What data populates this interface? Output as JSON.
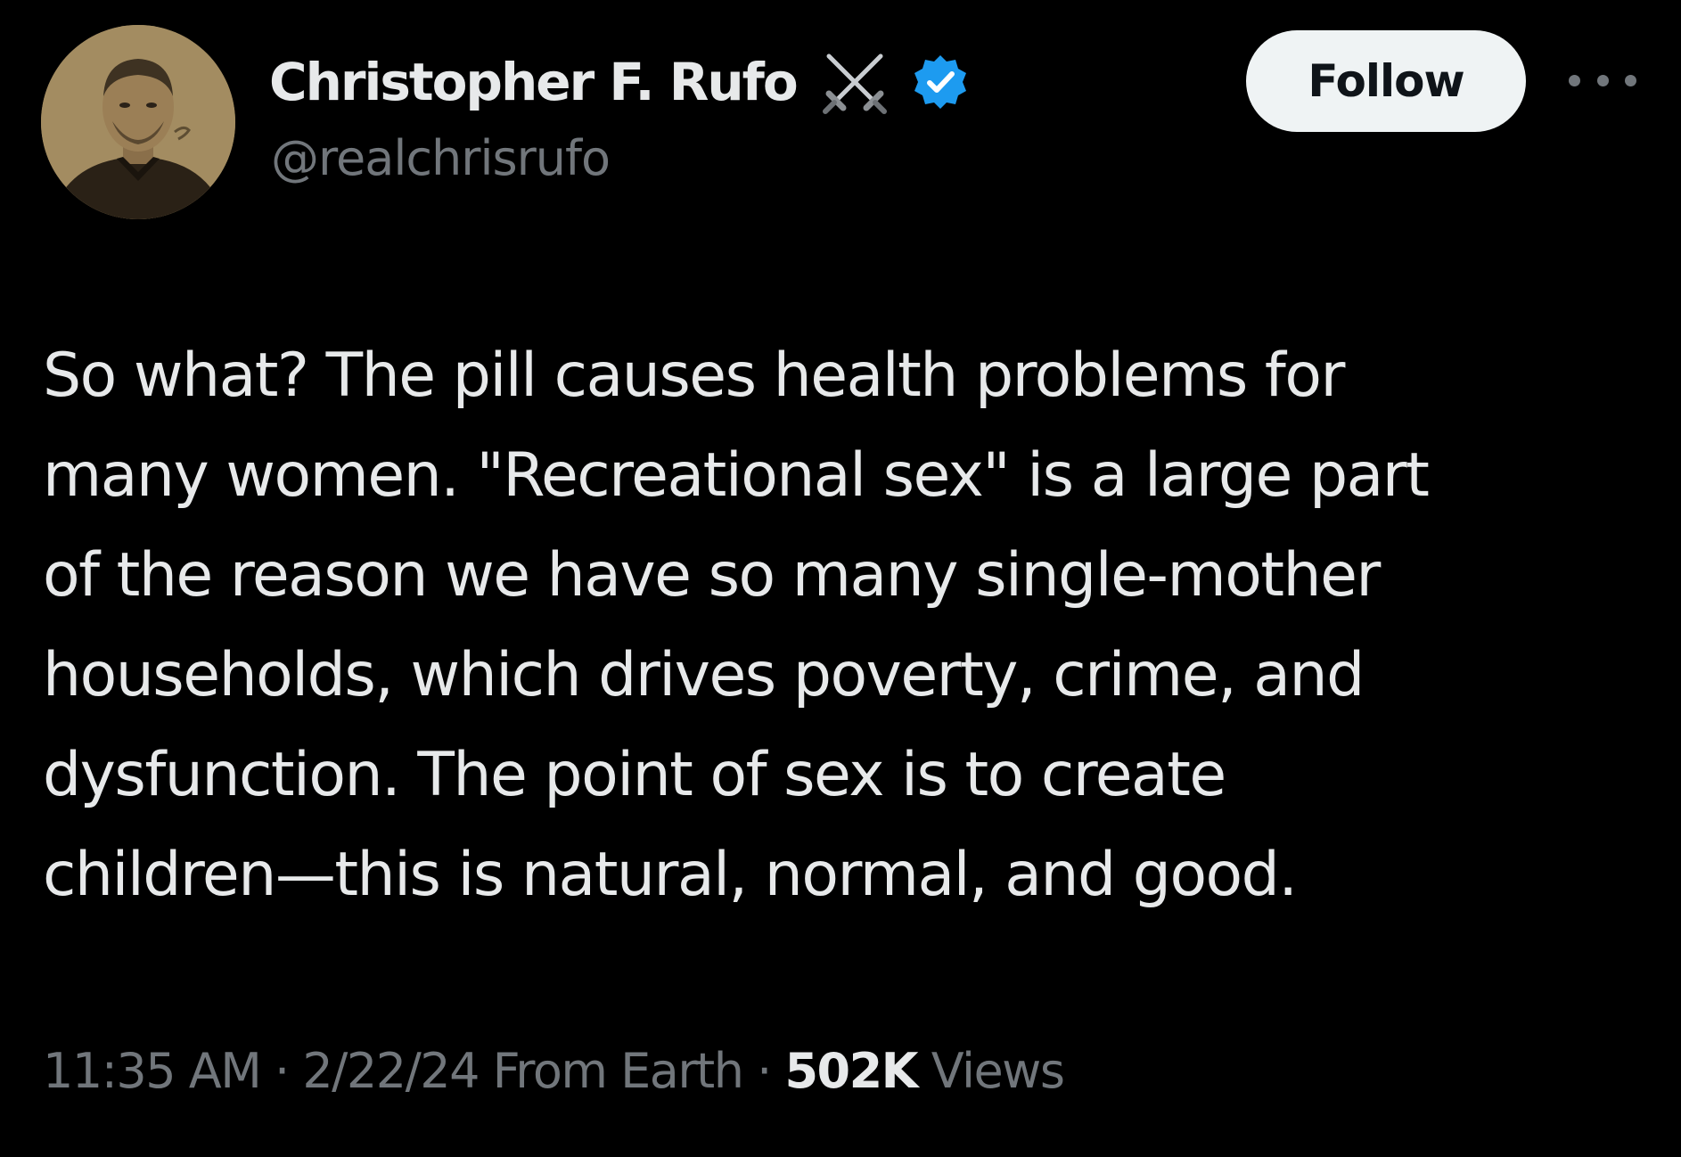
{
  "author": {
    "display_name": "Christopher F. Rufo",
    "handle": "@realchrisrufo",
    "badge_icon": "crossed-swords-icon",
    "verified_icon": "verified-badge-icon",
    "verified_color": "#1d9bf0"
  },
  "actions": {
    "follow_label": "Follow",
    "more_icon": "more-options-icon"
  },
  "tweet": {
    "lines": [
      "So what? The pill causes health problems for",
      "many women. \"Recreational sex\" is a large part",
      "of the reason we have so many single-mother",
      "households, which drives poverty, crime, and",
      "dysfunction. The point of sex is to create",
      "children—this is natural, normal, and good."
    ]
  },
  "meta": {
    "time": "11:35 AM",
    "separator": " · ",
    "date": "2/22/24",
    "source": "From Earth",
    "views_count": "502K",
    "views_label": "Views"
  },
  "colors": {
    "background": "#000000",
    "primary_text": "#e7e9ea",
    "secondary_text": "#71767b",
    "button_bg": "#eff3f4"
  }
}
